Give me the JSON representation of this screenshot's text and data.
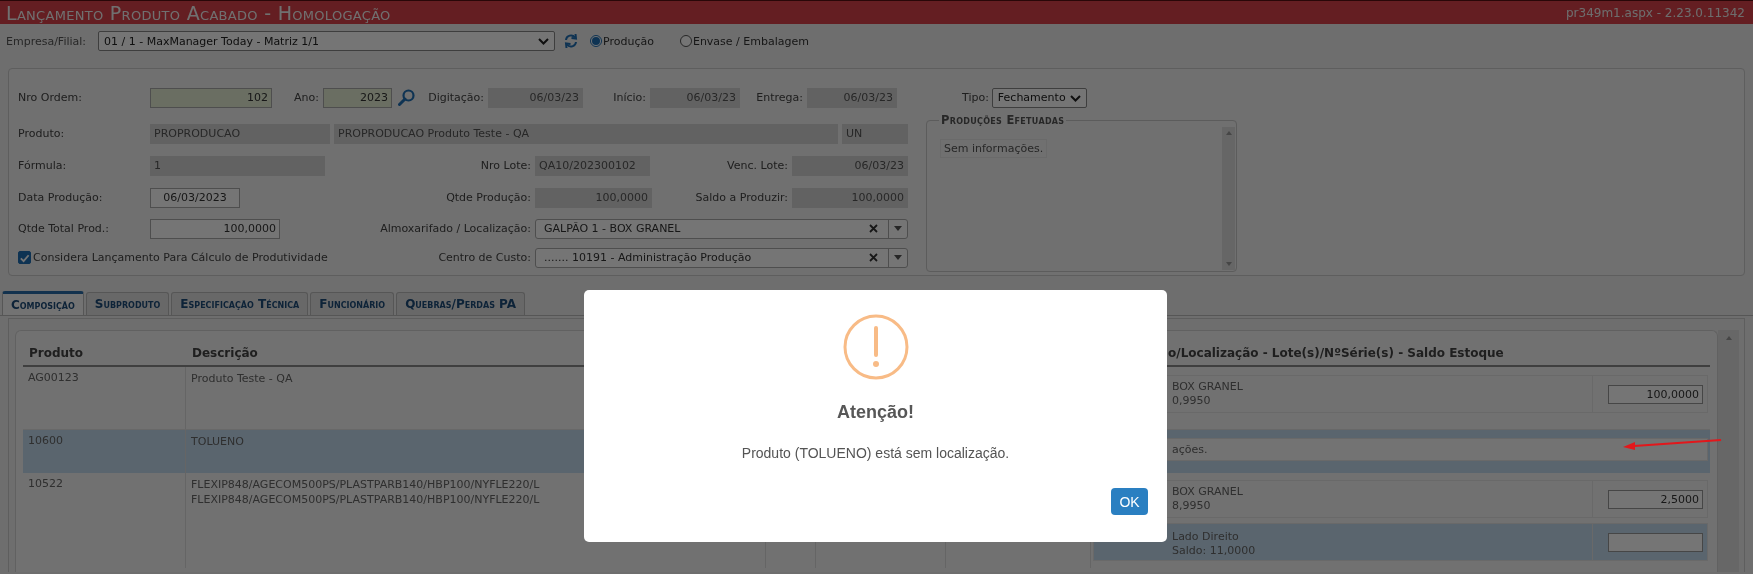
{
  "title_bar": {
    "title": "Lançamento Produto Acabado - Homologação",
    "version": "pr349m1.aspx - 2.23.0.11342"
  },
  "toolbar": {
    "company_label": "Empresa/Filial:",
    "company_value": "01 / 1 - MaxManager Today - Matriz 1/1",
    "modes": [
      {
        "label": "Produção",
        "selected": true
      },
      {
        "label": "Envase / Embalagem",
        "selected": false
      }
    ]
  },
  "form": {
    "rows": [
      [
        {
          "kind": "key",
          "label": "Nro Ordem:",
          "value": "102"
        },
        {
          "kind": "key",
          "label": "Ano:",
          "value": "2023"
        },
        {
          "kind": "search"
        },
        {
          "kind": "readonly",
          "label": "Digitação:",
          "value": "06/03/23"
        },
        {
          "kind": "readonly",
          "label": "Início:",
          "value": "06/03/23"
        },
        {
          "kind": "readonly",
          "label": "Entrega:",
          "value": "06/03/23"
        }
      ],
      [
        {
          "kind": "readonly",
          "label": "Produto:",
          "value": "PROPRODUCAO"
        },
        {
          "kind": "readonly",
          "value": "PROPRODUCAO Produto Teste - QA"
        },
        {
          "kind": "readonly",
          "value": "UN"
        }
      ],
      [
        {
          "kind": "readonly",
          "label": "Fórmula:",
          "value": "1"
        },
        {
          "kind": "readonly",
          "label": "Nro Lote:",
          "value": "QA10/202300102"
        },
        {
          "kind": "readonly",
          "label": "Venc. Lote:",
          "value": "06/03/23"
        }
      ],
      [
        {
          "kind": "input",
          "label": "Data Produção:",
          "value": "06/03/2023"
        },
        {
          "kind": "readonly",
          "label": "Qtde Produção:",
          "value": "100,0000"
        },
        {
          "kind": "readonly",
          "label": "Saldo a Produzir:",
          "value": "100,0000"
        }
      ],
      [
        {
          "kind": "input",
          "label": "Qtde Total Prod.:",
          "value": "100,0000"
        },
        {
          "kind": "combo",
          "label": "Almoxarifado / Localização:",
          "value": "GALPÃO 1 - BOX GRANEL"
        }
      ],
      [
        {
          "kind": "checkbox",
          "label": "Considera Lançamento Para Cálculo de Produtividade",
          "checked": true
        },
        {
          "kind": "combo",
          "label": "Centro de Custo:",
          "value": "....... 10191 - Administração Produção"
        }
      ]
    ],
    "type": {
      "label": "Tipo:",
      "value": "Fechamento"
    },
    "productions": {
      "legend": "Produções Efetuadas",
      "text": "Sem informações."
    }
  },
  "tabs": [
    {
      "label": "Composição",
      "selected": true
    },
    {
      "label": "Subproduto",
      "selected": false
    },
    {
      "label": "Especificação Técnica",
      "selected": false
    },
    {
      "label": "Funcionário",
      "selected": false
    },
    {
      "label": "Quebras/Perdas PA",
      "selected": false
    }
  ],
  "table": {
    "columns": [
      "Produto",
      "Descrição",
      "o/Localização - Lote(s)/NºSérie(s) - Saldo Estoque"
    ],
    "rows": [
      {
        "selected": false,
        "product": "AG00123",
        "description": "Produto Teste - QA",
        "stock": [
          {
            "kind": "stock",
            "location": "BOX GRANEL",
            "balance": "0,9950",
            "quantity": "100,0000",
            "selected": false
          }
        ]
      },
      {
        "selected": true,
        "product": "10600",
        "description": "TOLUENO",
        "stock": [
          {
            "kind": "note",
            "text": "ações."
          }
        ]
      },
      {
        "selected": false,
        "product": "10522",
        "description": "FLEXIP848/AGECOM500PS/PLASTPARB140/HBP100/NYFLE220/L\nFLEXIP848/AGECOM500PS/PLASTPARB140/HBP100/NYFLE220/L",
        "stock": [
          {
            "kind": "stock",
            "location": "BOX GRANEL",
            "balance": "8,9950",
            "quantity": "2,5000",
            "selected": false
          },
          {
            "kind": "stock",
            "location": "Lado Direito",
            "balance": "Saldo: 11,0000",
            "selected": true
          }
        ]
      }
    ]
  },
  "dialog": {
    "title": "Atenção!",
    "message": "Produto (TOLUENO) está sem localização.",
    "button": "OK"
  }
}
